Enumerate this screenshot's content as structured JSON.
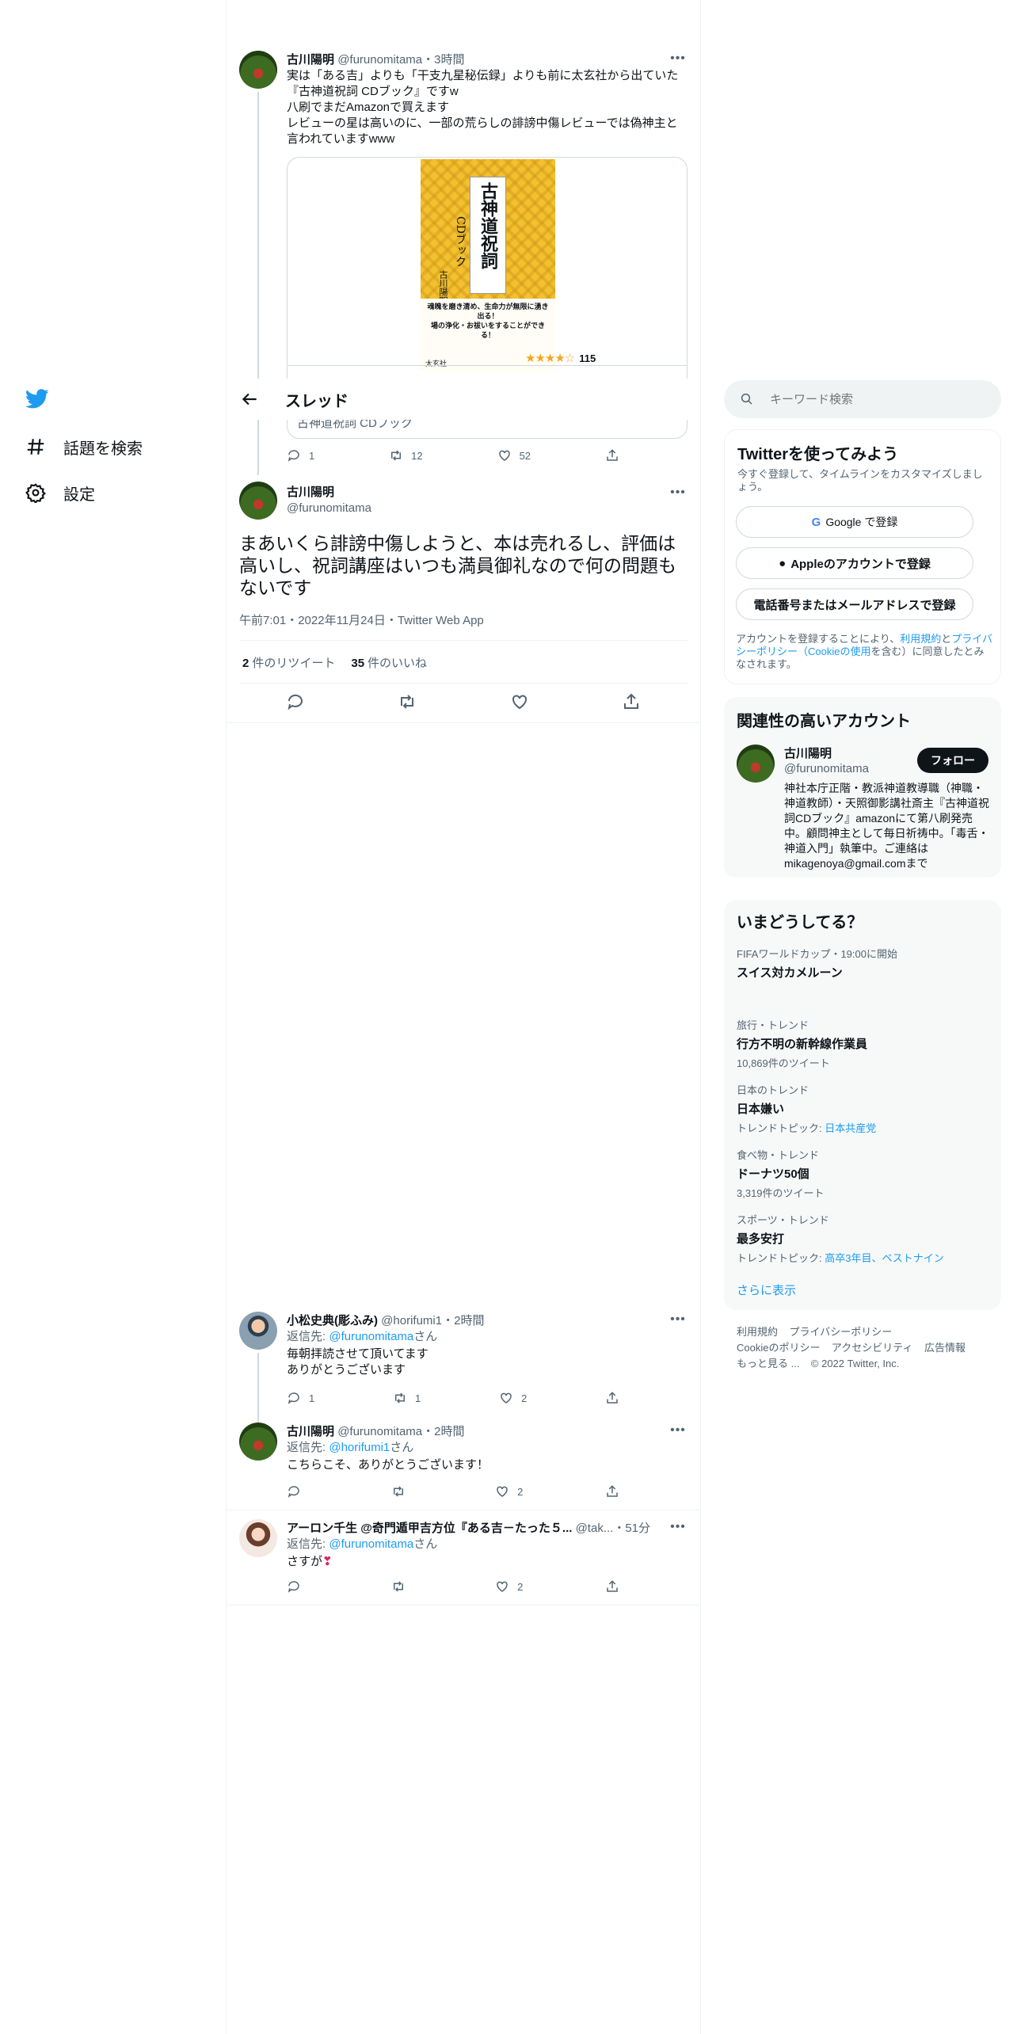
{
  "nav": {
    "explore": "話題を検索",
    "settings": "設定"
  },
  "header": {
    "title": "スレッド"
  },
  "tweet1": {
    "name": "古川陽明",
    "handle": "@furunomitama",
    "time": "3時間",
    "lines": [
      "実は「ある吉」よりも「干支九星秘伝録」よりも前に太玄社から出ていた",
      "『古神道祝詞 CDブック』ですw",
      "八刷でまだAmazonで買えます",
      "レビューの星は高いのに、一部の荒らしの誹謗中傷レビューでは偽神主と",
      "言われていますwww"
    ],
    "book": {
      "title": "古神道祝詞",
      "subtitle": "CDブック",
      "author": "古川陽明",
      "caption": "魂魄を磨き清め、生命力が無限に湧き出る！",
      "caption2": "場の浄化・お祓いをすることができる！",
      "publisher": "太玄社",
      "rating_count": "115"
    },
    "card_title": "古神道祝詞 CDブック",
    "replies": "1",
    "retweets": "12",
    "likes": "52"
  },
  "main_tweet": {
    "name": "古川陽明",
    "handle": "@furunomitama",
    "text": "まあいくら誹謗中傷しようと、本は売れるし、評価は高いし、祝詞講座はいつも満員御礼なので何の問題もないです",
    "meta": "午前7:01・2022年11月24日・Twitter Web App",
    "retweet_count": "2",
    "retweet_label": "件のリツイート",
    "like_count": "35",
    "like_label": "件のいいね"
  },
  "reply1": {
    "name": "小松史典(彫ふみ)",
    "handle": "@horifumi1",
    "time": "2時間",
    "reply_to_prefix": "返信先: ",
    "reply_to": "@furunomitama",
    "reply_to_suffix": "さん",
    "lines": [
      "毎朝拝読させて頂いてます",
      "ありがとうございます"
    ],
    "replies": "1",
    "retweets": "1",
    "likes": "2"
  },
  "reply2": {
    "name": "古川陽明",
    "handle": "@furunomitama",
    "time": "2時間",
    "reply_to_prefix": "返信先: ",
    "reply_to": "@horifumi1",
    "reply_to_suffix": "さん",
    "text": "こちらこそ、ありがとうございます！",
    "likes": "2"
  },
  "reply3": {
    "name": "アーロン千生 @奇門遁甲吉方位『ある吉－たった５...",
    "handle": "@tak...",
    "time": "51分",
    "reply_to_prefix": "返信先: ",
    "reply_to": "@furunomitama",
    "reply_to_suffix": "さん",
    "text": "さすが",
    "likes": "2"
  },
  "search": {
    "placeholder": "キーワード検索"
  },
  "signup": {
    "title": "Twitterを使ってみよう",
    "subtitle": "今すぐ登録して、タイムラインをカスタマイズしましょう。",
    "google": "Google で登録",
    "apple": "Appleのアカウントで登録",
    "phone": "電話番号またはメールアドレスで登録",
    "legal_1": "アカウントを登録することにより、",
    "legal_terms": "利用規約",
    "legal_2": "と",
    "legal_privacy": "プライバシーポリシー",
    "legal_cookie": "（Cookieの使用",
    "legal_3": "を含む）に同意したとみなされます。"
  },
  "related": {
    "title": "関連性の高いアカウント",
    "name": "古川陽明",
    "handle": "@furunomitama",
    "follow": "フォロー",
    "bio": "神社本庁正階・教派神道教導職（神職・神道教師）・天照御影講社斎主『古神道祝詞CDブック』amazonにて第八刷発売中。顧問神主として毎日祈祷中。「毒舌・神道入門」執筆中。ご連絡はmikagenoya@gmail.comまで"
  },
  "trends": {
    "title": "いまどうしてる？",
    "items": [
      {
        "category": "FIFAワールドカップ・19:00に開始",
        "title": "スイス対カメルーン",
        "sub": ""
      },
      {
        "category": "旅行・トレンド",
        "title": "行方不明の新幹線作業員",
        "sub": "10,869件のツイート"
      },
      {
        "category": "日本のトレンド",
        "title": "日本嫌い",
        "sub_prefix": "トレンドトピック: ",
        "sub_link": "日本共産党"
      },
      {
        "category": "食べ物・トレンド",
        "title": "ドーナツ50個",
        "sub": "3,319件のツイート"
      },
      {
        "category": "スポーツ・トレンド",
        "title": "最多安打",
        "sub_prefix": "トレンドトピック: ",
        "sub_link": "高卒3年目、ベストナイン"
      }
    ],
    "more": "さらに表示"
  },
  "footer": {
    "terms": "利用規約",
    "privacy": "プライバシーポリシー",
    "cookie": "Cookieのポリシー",
    "accessibility": "アクセシビリティ",
    "ads": "広告情報",
    "more": "もっと見る ...",
    "copyright": "© 2022 Twitter, Inc."
  },
  "colors": {
    "accent": "#1d9bf0",
    "text": "#0f1419",
    "muted": "#536471",
    "book_yellow": "#f2c12e"
  }
}
